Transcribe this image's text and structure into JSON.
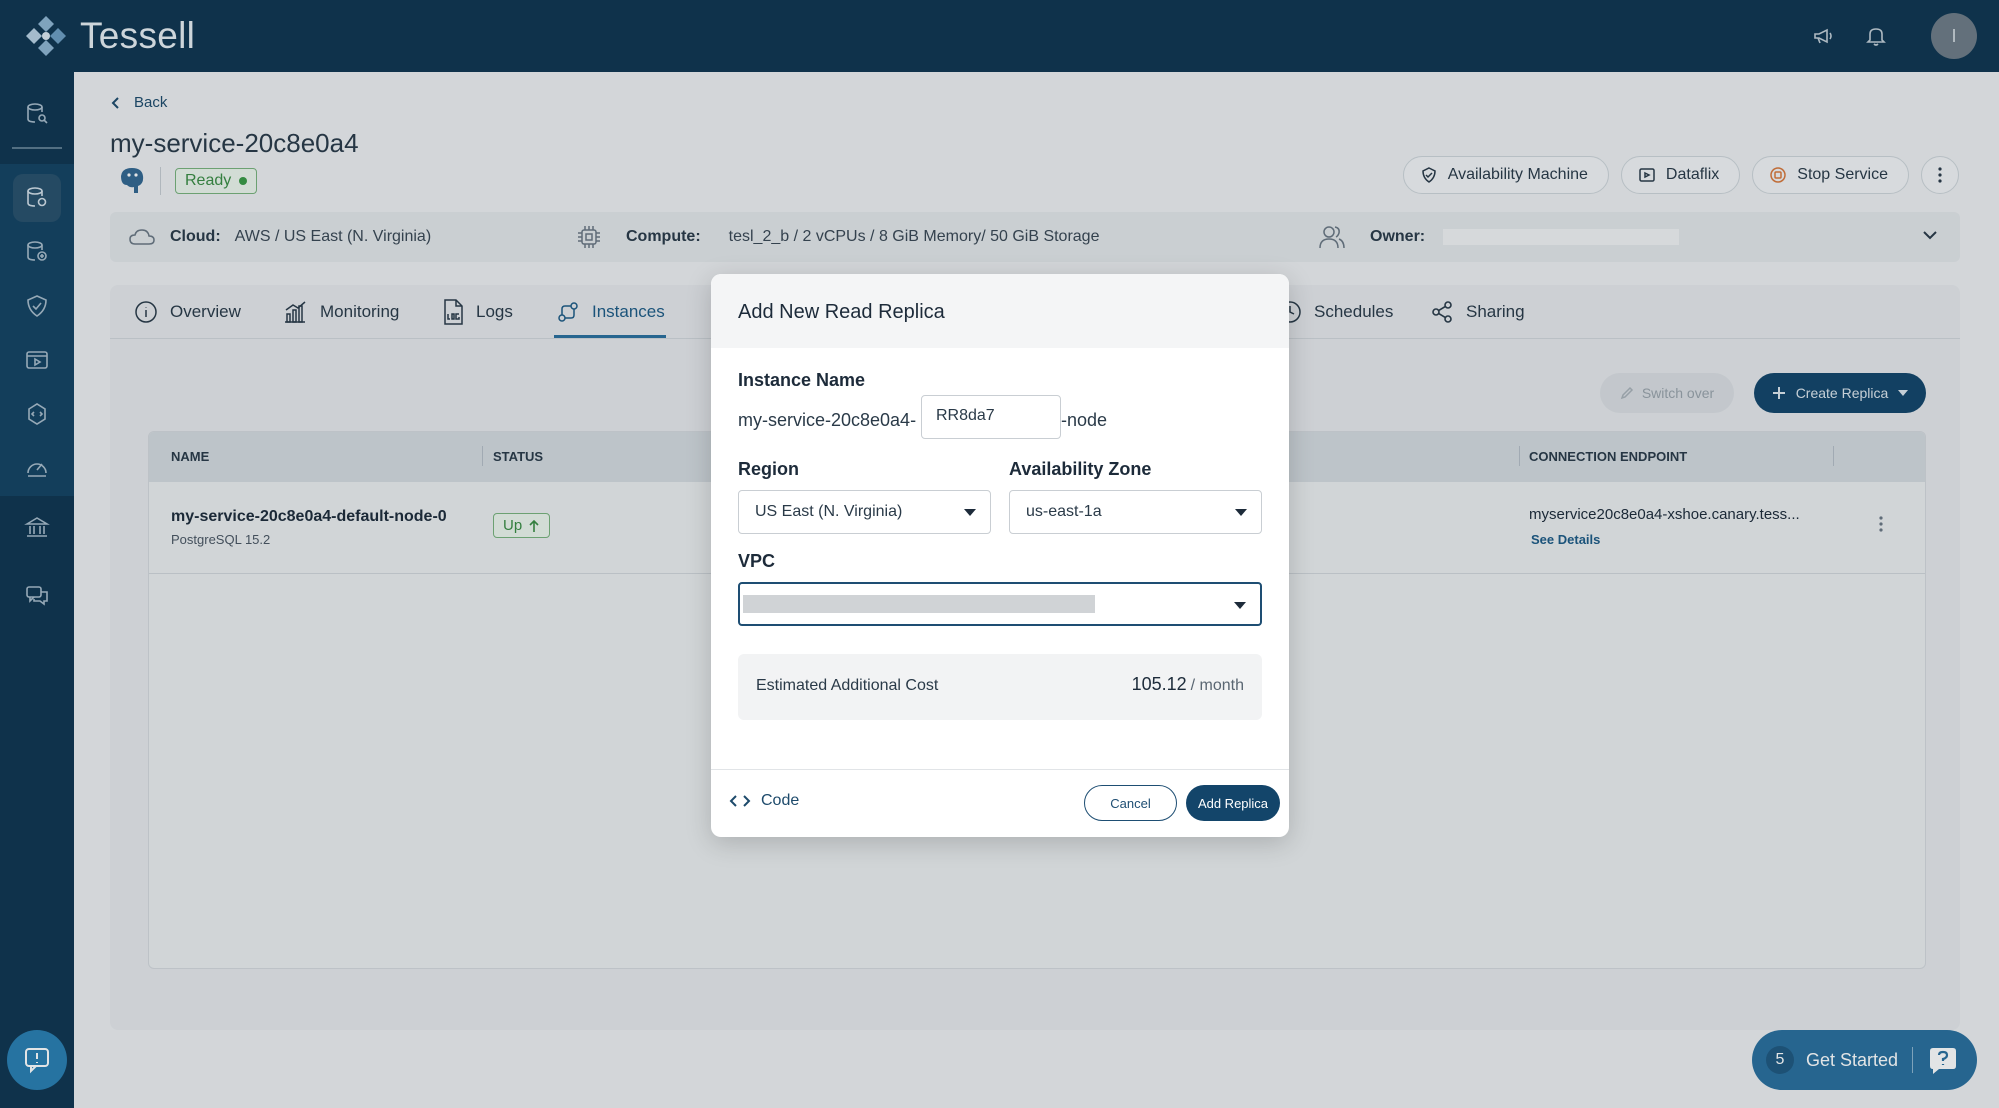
{
  "app": {
    "brand": "Tessell"
  },
  "user": {
    "avatar_initial": "I"
  },
  "nav": {
    "back_label": "Back"
  },
  "service": {
    "name": "my-service-20c8e0a4",
    "status": "Ready"
  },
  "actions": {
    "availability_machine": "Availability Machine",
    "dataflix": "Dataflix",
    "stop_service": "Stop Service"
  },
  "info": {
    "cloud_label": "Cloud:",
    "cloud_value": "AWS / US East (N. Virginia)",
    "compute_label": "Compute:",
    "compute_value": "tesl_2_b / 2 vCPUs / 8 GiB Memory/ 50 GiB Storage",
    "owner_label": "Owner:"
  },
  "tabs": [
    {
      "label": "Overview"
    },
    {
      "label": "Monitoring"
    },
    {
      "label": "Logs"
    },
    {
      "label": "Instances"
    },
    {
      "label": "Schedules"
    },
    {
      "label": "Sharing"
    }
  ],
  "instances": {
    "switch_over": "Switch over",
    "create_replica": "Create Replica",
    "columns": {
      "name": "NAME",
      "status": "STATUS",
      "endpoint": "CONNECTION ENDPOINT"
    },
    "rows": [
      {
        "name": "my-service-20c8e0a4-default-node-0",
        "version": "PostgreSQL 15.2",
        "status": "Up",
        "endpoint": "myservice20c8e0a4-xshoe.canary.tess...",
        "details": "See Details"
      }
    ]
  },
  "get_started": {
    "count": "5",
    "label": "Get Started"
  },
  "modal": {
    "title": "Add New Read Replica",
    "instance_name_label": "Instance Name",
    "prefix": "my-service-20c8e0a4-",
    "name_value": "RR8da7",
    "suffix": "-node",
    "region_label": "Region",
    "region_value": "US East (N. Virginia)",
    "az_label": "Availability Zone",
    "az_value": "us-east-1a",
    "vpc_label": "VPC",
    "cost_label": "Estimated Additional Cost",
    "cost_value": "105.12",
    "cost_unit": "/ month",
    "code_label": "Code",
    "cancel_label": "Cancel",
    "add_label": "Add Replica"
  },
  "colors": {
    "navy": "#0f3550",
    "primary": "#13456a",
    "success": "#3a8c43"
  }
}
